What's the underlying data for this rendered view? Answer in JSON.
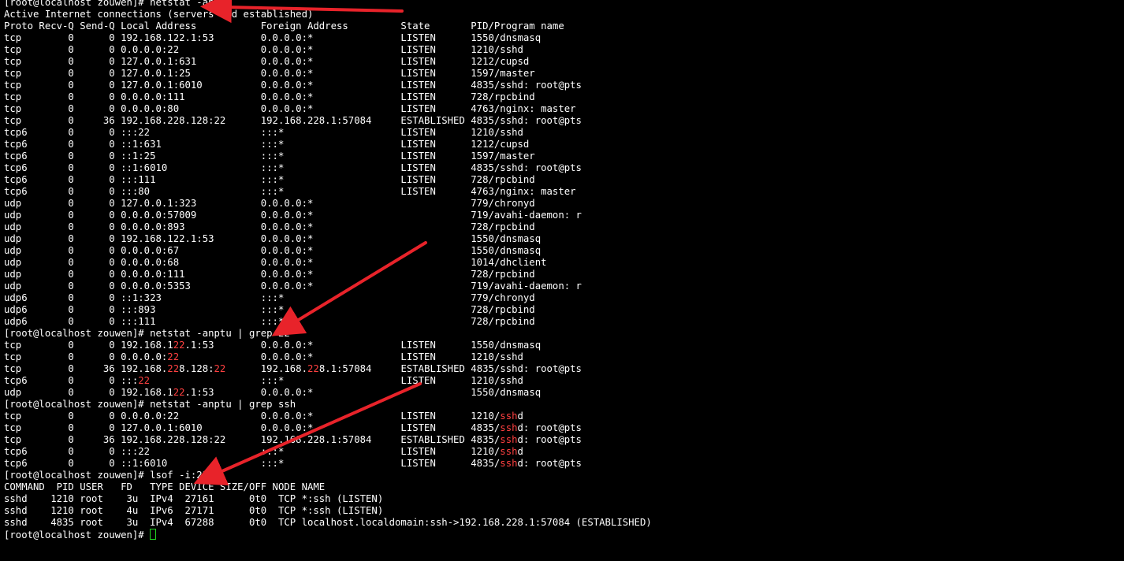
{
  "colors": {
    "background": "#000000",
    "text": "#ffffff",
    "match_highlight": "#ff4040",
    "cursor": "#22d322",
    "annotation_arrow": "#e8232a"
  },
  "terminal": {
    "lines": [
      [
        {
          "t": "[root@localhost zouwen]# netstat -anptu"
        }
      ],
      [
        {
          "t": "Active Internet connections (servers and established)"
        }
      ],
      [
        {
          "t": "Proto Recv-Q Send-Q Local Address           Foreign Address         State       PID/Program name"
        }
      ],
      [
        {
          "t": "tcp        0      0 192.168.122.1:53        0.0.0.0:*               LISTEN      1550/dnsmasq"
        }
      ],
      [
        {
          "t": "tcp        0      0 0.0.0.0:22              0.0.0.0:*               LISTEN      1210/sshd"
        }
      ],
      [
        {
          "t": "tcp        0      0 127.0.0.1:631           0.0.0.0:*               LISTEN      1212/cupsd"
        }
      ],
      [
        {
          "t": "tcp        0      0 127.0.0.1:25            0.0.0.0:*               LISTEN      1597/master"
        }
      ],
      [
        {
          "t": "tcp        0      0 127.0.0.1:6010          0.0.0.0:*               LISTEN      4835/sshd: root@pts"
        }
      ],
      [
        {
          "t": "tcp        0      0 0.0.0.0:111             0.0.0.0:*               LISTEN      728/rpcbind"
        }
      ],
      [
        {
          "t": "tcp        0      0 0.0.0.0:80              0.0.0.0:*               LISTEN      4763/nginx: master"
        }
      ],
      [
        {
          "t": "tcp        0     36 192.168.228.128:22      192.168.228.1:57084     ESTABLISHED 4835/sshd: root@pts"
        }
      ],
      [
        {
          "t": "tcp6       0      0 :::22                   :::*                    LISTEN      1210/sshd"
        }
      ],
      [
        {
          "t": "tcp6       0      0 ::1:631                 :::*                    LISTEN      1212/cupsd"
        }
      ],
      [
        {
          "t": "tcp6       0      0 ::1:25                  :::*                    LISTEN      1597/master"
        }
      ],
      [
        {
          "t": "tcp6       0      0 ::1:6010                :::*                    LISTEN      4835/sshd: root@pts"
        }
      ],
      [
        {
          "t": "tcp6       0      0 :::111                  :::*                    LISTEN      728/rpcbind"
        }
      ],
      [
        {
          "t": "tcp6       0      0 :::80                   :::*                    LISTEN      4763/nginx: master"
        }
      ],
      [
        {
          "t": "udp        0      0 127.0.0.1:323           0.0.0.0:*                           779/chronyd"
        }
      ],
      [
        {
          "t": "udp        0      0 0.0.0.0:57009           0.0.0.0:*                           719/avahi-daemon: r"
        }
      ],
      [
        {
          "t": "udp        0      0 0.0.0.0:893             0.0.0.0:*                           728/rpcbind"
        }
      ],
      [
        {
          "t": "udp        0      0 192.168.122.1:53        0.0.0.0:*                           1550/dnsmasq"
        }
      ],
      [
        {
          "t": "udp        0      0 0.0.0.0:67              0.0.0.0:*                           1550/dnsmasq"
        }
      ],
      [
        {
          "t": "udp        0      0 0.0.0.0:68              0.0.0.0:*                           1014/dhclient"
        }
      ],
      [
        {
          "t": "udp        0      0 0.0.0.0:111             0.0.0.0:*                           728/rpcbind"
        }
      ],
      [
        {
          "t": "udp        0      0 0.0.0.0:5353            0.0.0.0:*                           719/avahi-daemon: r"
        }
      ],
      [
        {
          "t": "udp6       0      0 ::1:323                 :::*                                779/chronyd"
        }
      ],
      [
        {
          "t": "udp6       0      0 :::893                  :::*                                728/rpcbind"
        }
      ],
      [
        {
          "t": "udp6       0      0 :::111                  :::*                                728/rpcbind"
        }
      ],
      [
        {
          "t": "[root@localhost zouwen]# netstat -anptu | grep 22"
        }
      ],
      [
        {
          "t": "tcp        0      0 192.168.1"
        },
        {
          "t": "22",
          "hl": true
        },
        {
          "t": ".1:53        0.0.0.0:*               LISTEN      1550/dnsmasq"
        }
      ],
      [
        {
          "t": "tcp        0      0 0.0.0.0:"
        },
        {
          "t": "22",
          "hl": true
        },
        {
          "t": "              0.0.0.0:*               LISTEN      1210/sshd"
        }
      ],
      [
        {
          "t": "tcp        0     36 192.168."
        },
        {
          "t": "22",
          "hl": true
        },
        {
          "t": "8.128:"
        },
        {
          "t": "22",
          "hl": true
        },
        {
          "t": "      192.168."
        },
        {
          "t": "22",
          "hl": true
        },
        {
          "t": "8.1:57084     ESTABLISHED 4835/sshd: root@pts"
        }
      ],
      [
        {
          "t": "tcp6       0      0 :::"
        },
        {
          "t": "22",
          "hl": true
        },
        {
          "t": "                   :::*                    LISTEN      1210/sshd"
        }
      ],
      [
        {
          "t": "udp        0      0 192.168.1"
        },
        {
          "t": "22",
          "hl": true
        },
        {
          "t": ".1:53        0.0.0.0:*                           1550/dnsmasq"
        }
      ],
      [
        {
          "t": "[root@localhost zouwen]# netstat -anptu | grep ssh"
        }
      ],
      [
        {
          "t": "tcp        0      0 0.0.0.0:22              0.0.0.0:*               LISTEN      1210/"
        },
        {
          "t": "ssh",
          "hl": true
        },
        {
          "t": "d"
        }
      ],
      [
        {
          "t": "tcp        0      0 127.0.0.1:6010          0.0.0.0:*               LISTEN      4835/"
        },
        {
          "t": "ssh",
          "hl": true
        },
        {
          "t": "d: root@pts"
        }
      ],
      [
        {
          "t": "tcp        0     36 192.168.228.128:22      192.168.228.1:57084     ESTABLISHED 4835/"
        },
        {
          "t": "ssh",
          "hl": true
        },
        {
          "t": "d: root@pts"
        }
      ],
      [
        {
          "t": "tcp6       0      0 :::22                   :::*                    LISTEN      1210/"
        },
        {
          "t": "ssh",
          "hl": true
        },
        {
          "t": "d"
        }
      ],
      [
        {
          "t": "tcp6       0      0 ::1:6010                :::*                    LISTEN      4835/"
        },
        {
          "t": "ssh",
          "hl": true
        },
        {
          "t": "d: root@pts"
        }
      ],
      [
        {
          "t": "[root@localhost zouwen]# lsof -i:22"
        }
      ],
      [
        {
          "t": "COMMAND  PID USER   FD   TYPE DEVICE SIZE/OFF NODE NAME"
        }
      ],
      [
        {
          "t": "sshd    1210 root    3u  IPv4  27161      0t0  TCP *:ssh (LISTEN)"
        }
      ],
      [
        {
          "t": "sshd    1210 root    4u  IPv6  27171      0t0  TCP *:ssh (LISTEN)"
        }
      ],
      [
        {
          "t": "sshd    4835 root    3u  IPv4  67288      0t0  TCP localhost.localdomain:ssh->192.168.228.1:57084 (ESTABLISHED)"
        }
      ],
      [
        {
          "t": "[root@localhost zouwen]# "
        }
      ]
    ]
  },
  "annotations": {
    "arrow_icon": "red-arrow-icon"
  }
}
